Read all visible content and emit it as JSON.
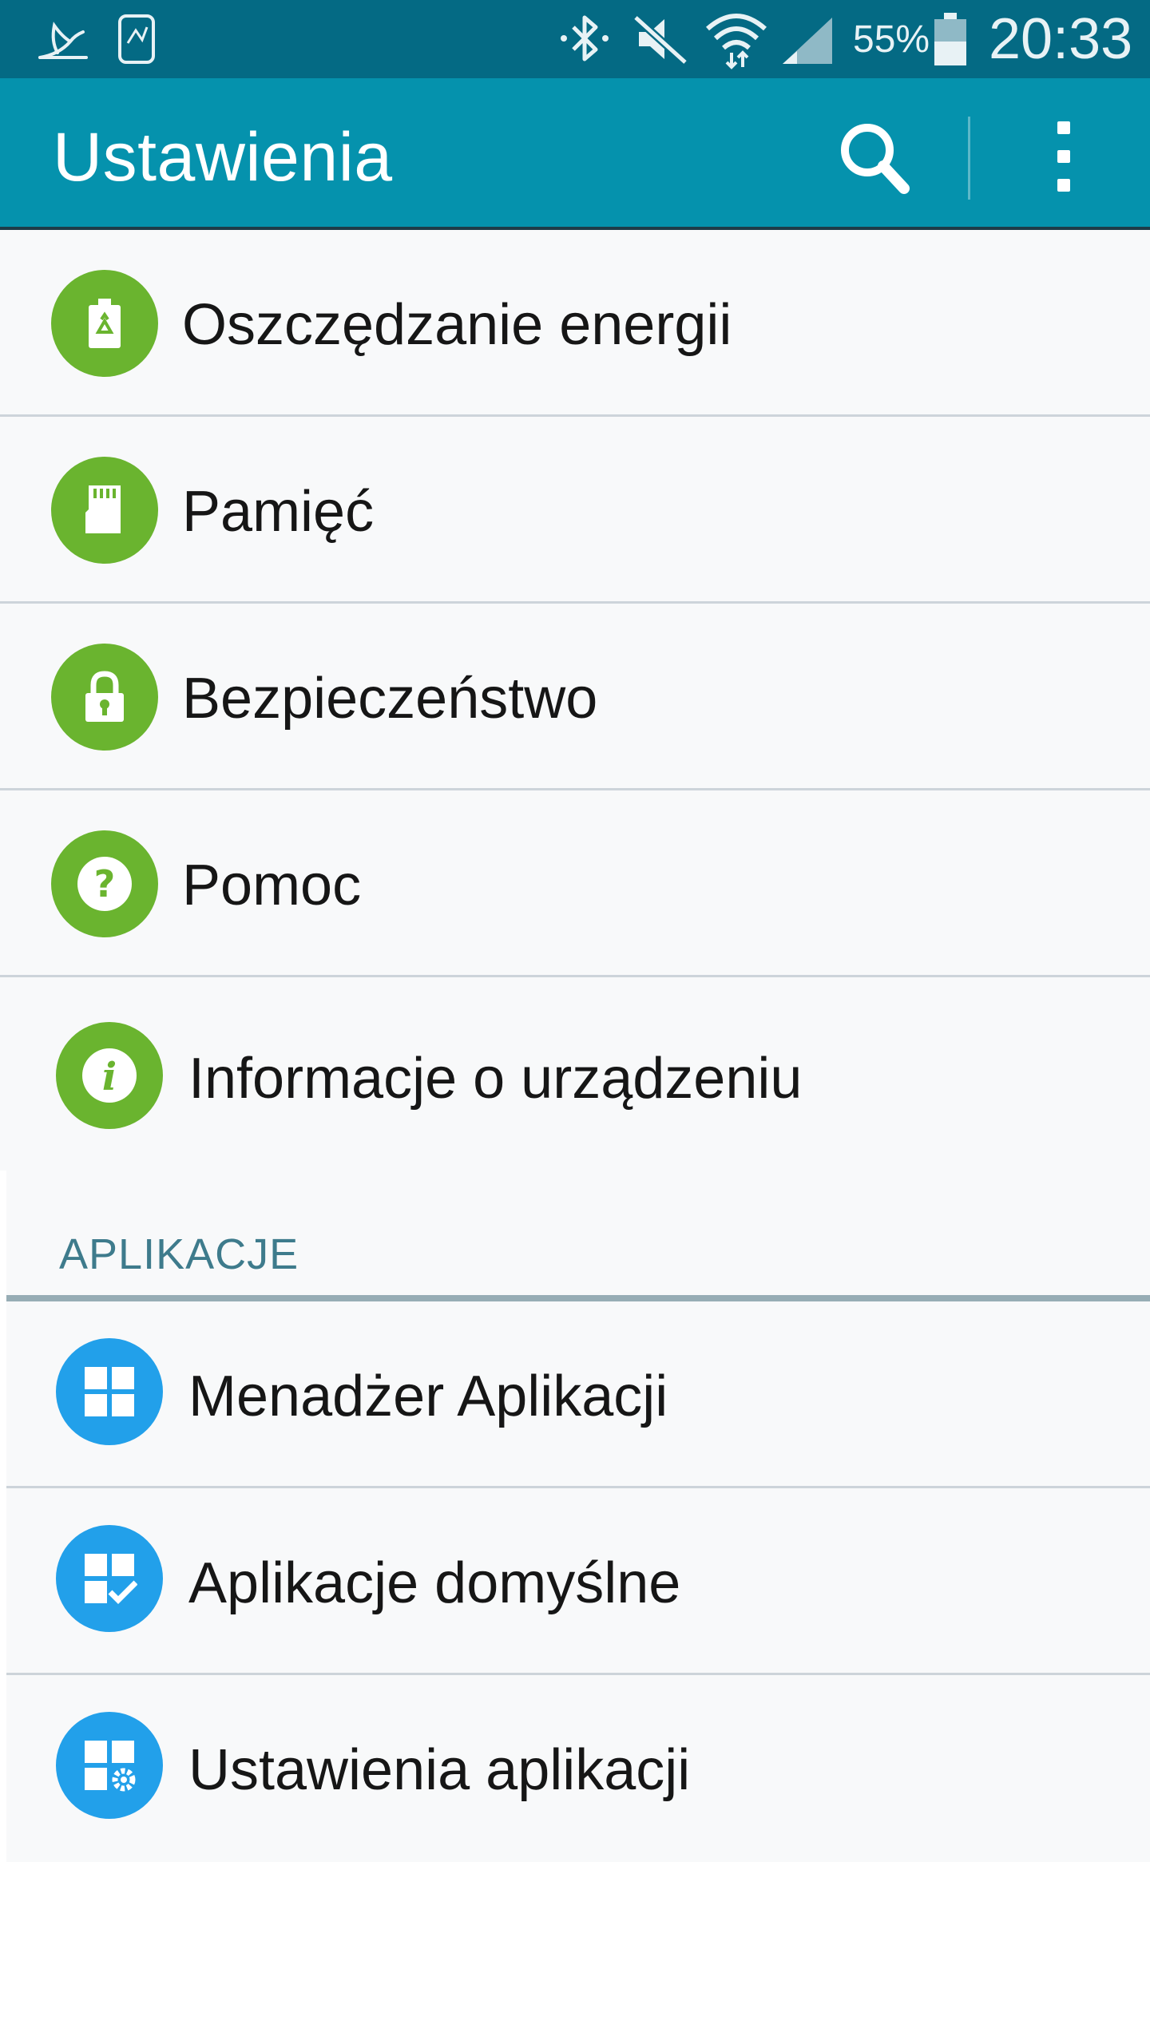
{
  "status_bar": {
    "icons": [
      "bird-notification-icon",
      "phone-notification-icon",
      "bluetooth-icon",
      "mute-icon",
      "wifi-icon",
      "signal-icon",
      "battery-icon"
    ],
    "battery_percent": "55%",
    "time": "20:33",
    "color": "#046a84"
  },
  "app_bar": {
    "title": "Ustawienia",
    "color": "#0592ad",
    "actions": [
      "search-icon",
      "more-vert-icon"
    ]
  },
  "system_items": [
    {
      "label": "Oszczędzanie energii",
      "icon": "battery-recycle-icon",
      "color": "#6ab42f"
    },
    {
      "label": "Pamięć",
      "icon": "sd-card-icon",
      "color": "#6ab42f"
    },
    {
      "label": "Bezpieczeństwo",
      "icon": "lock-icon",
      "color": "#6ab42f"
    },
    {
      "label": "Pomoc",
      "icon": "help-icon",
      "color": "#6ab42f"
    },
    {
      "label": "Informacje o urządzeniu",
      "icon": "info-icon",
      "color": "#6ab42f"
    }
  ],
  "apps_section": {
    "header": "APLIKACJE",
    "items": [
      {
        "label": "Menadżer Aplikacji",
        "icon": "app-grid-icon",
        "color": "#22a0ea"
      },
      {
        "label": "Aplikacje domyślne",
        "icon": "app-grid-check-icon",
        "color": "#22a0ea"
      },
      {
        "label": "Ustawienia aplikacji",
        "icon": "app-grid-gear-icon",
        "color": "#22a0ea"
      }
    ]
  }
}
